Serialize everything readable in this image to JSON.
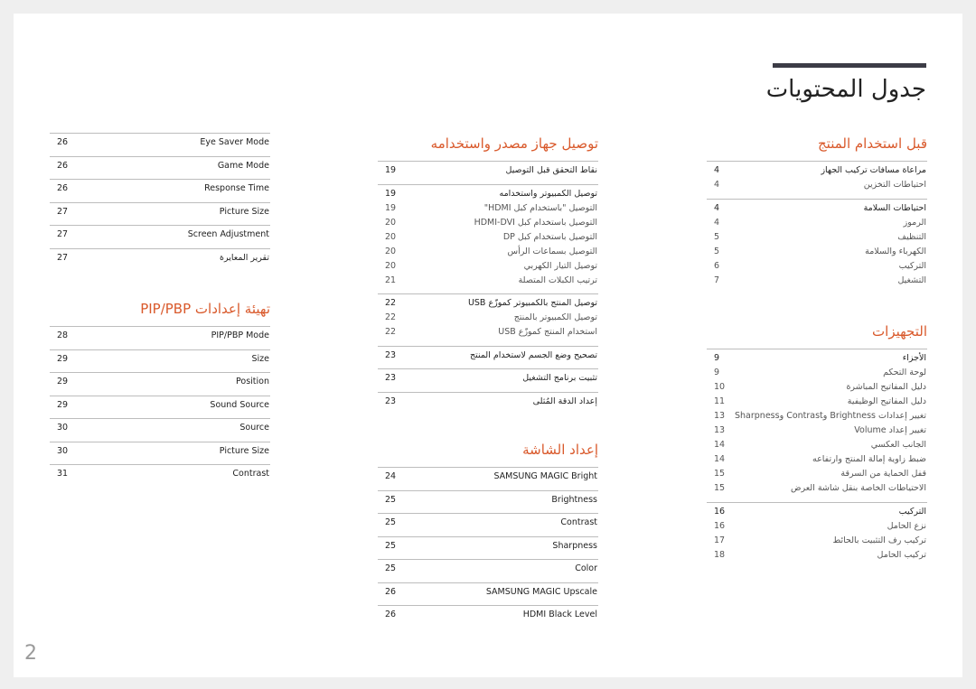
{
  "title": "جدول المحتويات",
  "page_number": "2",
  "colors": {
    "accent": "#d9592b",
    "bar": "#3c3c46"
  },
  "right": [
    {
      "title": "قبل استخدام المنتج",
      "groups": [
        [
          [
            "مراعاة مسافات تركيب الجهاز",
            "4"
          ],
          [
            "احتياطات التخزين",
            "4"
          ]
        ],
        [
          [
            "احتياطات السلامة",
            "4"
          ],
          [
            "الرموز",
            "4"
          ],
          [
            "التنظيف",
            "5"
          ],
          [
            "الكهرباء والسلامة",
            "5"
          ],
          [
            "التركيب",
            "6"
          ],
          [
            "التشغيل",
            "7"
          ]
        ]
      ]
    },
    {
      "title": "التجهيزات",
      "groups": [
        [
          [
            "الأجزاء",
            "9"
          ],
          [
            "لوحة التحكم",
            "9"
          ],
          [
            "دليل المفاتيح المباشرة",
            "10"
          ],
          [
            "دليل المفاتيح الوظيفية",
            "11"
          ],
          [
            "تغيير إعدادات Brightness وContrast وSharpness",
            "13"
          ],
          [
            "تغيير إعداد Volume",
            "13"
          ],
          [
            "الجانب العكسي",
            "14"
          ],
          [
            "ضبط زاوية إمالة المنتج وارتفاعه",
            "14"
          ],
          [
            "قفل الحماية من السرقة",
            "15"
          ],
          [
            "الاحتياطات الخاصة بنقل شاشة العرض",
            "15"
          ]
        ],
        [
          [
            "التركيب",
            "16"
          ],
          [
            "نزع الحامل",
            "16"
          ],
          [
            "تركيب رف التثبيت بالحائط",
            "17"
          ],
          [
            "تركيب الحامل",
            "18"
          ]
        ]
      ]
    }
  ],
  "middle": [
    {
      "title": "توصيل جهاز مصدر واستخدامه",
      "groups": [
        [
          [
            "نقاط التحقق قبل التوصيل",
            "19"
          ]
        ],
        [
          [
            "توصيل الكمبيوتر واستخدامه",
            "19"
          ],
          [
            "التوصيل \"باستخدام كبل HDMI\"",
            "19"
          ],
          [
            "التوصيل باستخدام كبل HDMI-DVI",
            "20"
          ],
          [
            "التوصيل باستخدام كبل DP",
            "20"
          ],
          [
            "التوصيل بسماعات الرأس",
            "20"
          ],
          [
            "توصيل التيار الكهربي",
            "20"
          ],
          [
            "ترتيب الكبلات المتصلة",
            "21"
          ]
        ],
        [
          [
            "توصيل المنتج بالكمبيوتر كموزّع USB",
            "22"
          ],
          [
            "توصيل الكمبيوتر بالمنتج",
            "22"
          ],
          [
            "استخدام المنتج كموزّع USB",
            "22"
          ]
        ],
        [
          [
            "تصحيح وضع الجسم لاستخدام المنتج",
            "23"
          ]
        ],
        [
          [
            "تثبيت برنامج التشغيل",
            "23"
          ]
        ],
        [
          [
            "إعداد الدقة المُثلى",
            "23"
          ]
        ]
      ]
    },
    {
      "title": "إعداد الشاشة",
      "groups": [
        [
          [
            "SAMSUNG MAGIC Bright",
            "24"
          ]
        ],
        [
          [
            "Brightness",
            "25"
          ]
        ],
        [
          [
            "Contrast",
            "25"
          ]
        ],
        [
          [
            "Sharpness",
            "25"
          ]
        ],
        [
          [
            "Color",
            "25"
          ]
        ],
        [
          [
            "SAMSUNG MAGIC Upscale",
            "26"
          ]
        ],
        [
          [
            "HDMI Black Level",
            "26"
          ]
        ]
      ]
    }
  ],
  "left": [
    {
      "title": "",
      "groups": [
        [
          [
            "Eye Saver Mode",
            "26"
          ]
        ],
        [
          [
            "Game Mode",
            "26"
          ]
        ],
        [
          [
            "Response Time",
            "26"
          ]
        ],
        [
          [
            "Picture Size",
            "27"
          ]
        ],
        [
          [
            "Screen Adjustment",
            "27"
          ]
        ],
        [
          [
            "تقرير المعايرة",
            "27"
          ]
        ]
      ]
    },
    {
      "title": "تهيئة إعدادات PIP/PBP",
      "groups": [
        [
          [
            "PIP/PBP Mode",
            "28"
          ]
        ],
        [
          [
            "Size",
            "29"
          ]
        ],
        [
          [
            "Position",
            "29"
          ]
        ],
        [
          [
            "Sound Source",
            "29"
          ]
        ],
        [
          [
            "Source",
            "30"
          ]
        ],
        [
          [
            "Picture Size",
            "30"
          ]
        ],
        [
          [
            "Contrast",
            "31"
          ]
        ]
      ]
    }
  ]
}
